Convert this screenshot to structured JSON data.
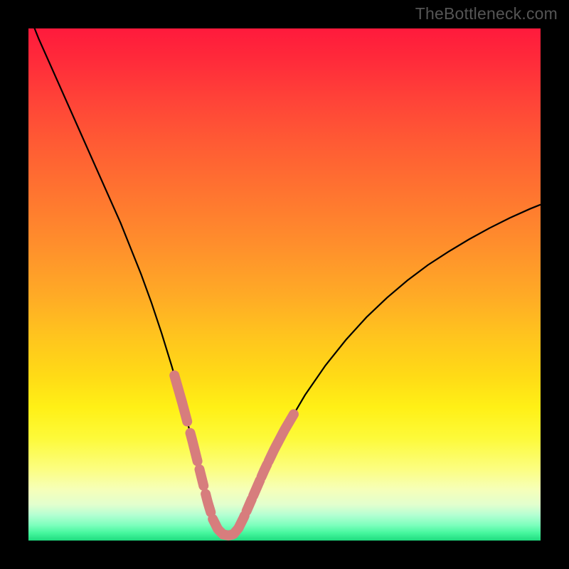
{
  "watermark": "TheBottleneck.com",
  "colors": {
    "curve": "#000000",
    "highlight": "#d77d7d",
    "frame": "#000000"
  },
  "chart_data": {
    "type": "line",
    "title": "",
    "xlabel": "",
    "ylabel": "",
    "xlim": [
      0,
      100
    ],
    "ylim": [
      0,
      100
    ],
    "series": [
      {
        "name": "bottleneck-curve",
        "x": [
          0,
          2,
          4,
          6,
          8,
          10,
          12,
          14,
          16,
          18,
          20,
          22,
          24,
          26,
          28,
          30,
          32,
          34,
          35,
          36,
          37,
          38,
          39,
          40,
          41,
          42,
          44,
          46,
          48,
          50,
          54,
          58,
          62,
          66,
          70,
          74,
          78,
          82,
          86,
          90,
          94,
          98,
          100
        ],
        "y": [
          103,
          98,
          93.5,
          89,
          84.5,
          80,
          75.5,
          71,
          66.5,
          62,
          57,
          52,
          46.5,
          40.5,
          34,
          27,
          19.5,
          11.5,
          7.5,
          4.2,
          2.2,
          1.2,
          1.0,
          1.2,
          2.4,
          4.4,
          9.0,
          13.6,
          17.8,
          21.6,
          28.4,
          34.2,
          39.2,
          43.6,
          47.4,
          50.8,
          53.8,
          56.4,
          58.8,
          61.0,
          63.0,
          64.8,
          65.6
        ]
      }
    ],
    "highlight_segments": [
      {
        "side": "left",
        "x_range": [
          28.5,
          31.0
        ]
      },
      {
        "side": "left",
        "x_range": [
          31.6,
          33.0
        ]
      },
      {
        "side": "left",
        "x_range": [
          33.4,
          34.2
        ]
      },
      {
        "side": "left",
        "x_range": [
          34.6,
          35.6
        ]
      },
      {
        "side": "left",
        "x_range": [
          36.0,
          37.2
        ]
      },
      {
        "side": "left",
        "x_range": [
          37.5,
          40.6
        ]
      },
      {
        "side": "right",
        "x_range": [
          40.8,
          42.2
        ]
      },
      {
        "side": "right",
        "x_range": [
          42.6,
          43.6
        ]
      },
      {
        "side": "right",
        "x_range": [
          43.9,
          45.2
        ]
      },
      {
        "side": "right",
        "x_range": [
          45.5,
          46.6
        ]
      },
      {
        "side": "right",
        "x_range": [
          46.9,
          51.8
        ]
      }
    ]
  }
}
